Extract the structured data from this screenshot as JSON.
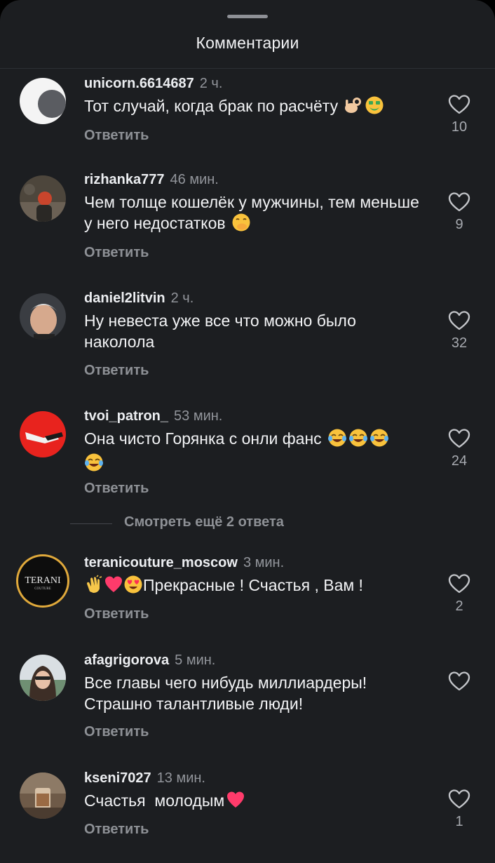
{
  "header": {
    "title": "Комментарии"
  },
  "colors": {
    "background": "#1c1e21",
    "text": "#f2f3f5",
    "muted": "#8e9196",
    "heart_emoji": "#ff3b6b"
  },
  "comments": [
    {
      "username": "unicorn.6614687",
      "time": "2 ч.",
      "text": "Тот случай, когда брак по расчёту",
      "emojis": [
        "ok-hand-icon",
        "money-mouth-face-icon"
      ],
      "reply": "Ответить",
      "likes": "10"
    },
    {
      "username": "rizhanka777",
      "time": "46 мин.",
      "text": "Чем толще кошелёк у мужчины, тем меньше у него недостатков",
      "emojis": [
        "hand-over-mouth-face-icon"
      ],
      "reply": "Ответить",
      "likes": "9"
    },
    {
      "username": "daniel2litvin",
      "time": "2 ч.",
      "text": "Ну невеста уже все что можно было наколола",
      "emojis": [],
      "reply": "Ответить",
      "likes": "32"
    },
    {
      "username": "tvoi_patron_",
      "time": "53 мин.",
      "text": "Она чисто Горянка с онли фанс",
      "emojis": [
        "tears-of-joy-icon",
        "tears-of-joy-icon",
        "tears-of-joy-icon",
        "tears-of-joy-icon"
      ],
      "reply": "Ответить",
      "likes": "24"
    },
    {
      "username": "teranicouture_moscow",
      "time": "3 мин.",
      "text": "Прекрасные ! Счастья , Вам !",
      "emojis": [
        "clapping-hands-icon",
        "pink-heart-icon",
        "heart-eyes-face-icon"
      ],
      "reply": "Ответить",
      "likes": "2"
    },
    {
      "username": "afagrigorova",
      "time": "5 мин.",
      "text": "Все главы чего нибудь миллиардеры! Страшно талантливые люди!",
      "emojis": [],
      "reply": "Ответить",
      "likes": ""
    },
    {
      "username": "kseni7027",
      "time": "13 мин.",
      "text": "Счастья  молодым",
      "emojis": [
        "pink-heart-icon"
      ],
      "reply": "Ответить",
      "likes": "1"
    }
  ],
  "view_more_replies": "Смотреть ещё 2 ответа",
  "avatar_texts": {
    "terani_logo": "TERANI",
    "terani_logo_sub": "COUTURE"
  }
}
